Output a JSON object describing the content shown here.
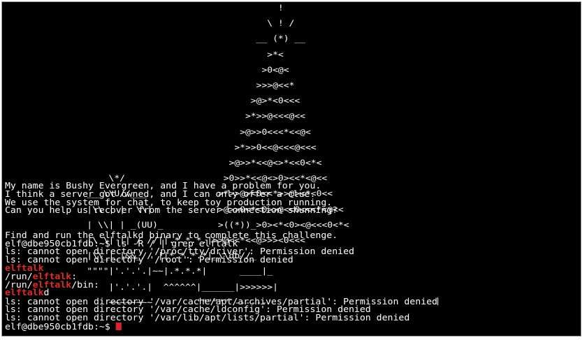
{
  "terminal": {
    "ascii_art": [
      "                                                  !",
      "                                                \\ ! /",
      "                                              __ (*) __",
      "                                                >*<",
      "                                               >0<@<",
      "                                              >>>@<<*",
      "                                             >@>*<0<<<",
      "                                            >*>>@<<<@<<",
      "                                           >@>>0<<<*<<@<",
      "                                          >*>>0<<@<<<@<<<",
      "                                         >@>>*<<@<>*<<0<*<",
      "                   \\*/                  >0>>*<<@<>0><<*<@<<",
      "               ___\\\\U//___             >*>>@><0<<*>>@><*<0<<",
      "               |\\\\ | |  \\\\|            >@>>0<*<0>>@<<0<<<*<@<<",
      "               | \\\\| | _(UU)_          >((*))_>0><*<0><@<<<0<*<",
      "               |\\ \\| || / //||.*.*.*.|>>@<<*<<@>>><0<<<",
      "               |\\\\_|_|&&_// ||*.*.*.*|_\\\\db//_",
      "               \"\"\"\"|'.'.'.|~~|.*.*.*|      ____|_",
      "                   |'.'.'.|  ^^^^^^|______|>>>>>>|",
      "                   ~~~~~~~~        '\"\"\"\"\"`------'"
    ],
    "output_lines": [
      [
        {
          "t": "My name is Bushy Evergreen, and I have a problem for you."
        }
      ],
      [
        {
          "t": "I think a server got owned, and I can only offer a clue."
        }
      ],
      [
        {
          "t": "We use the system for chat, to keep toy production running."
        }
      ],
      [
        {
          "t": "Can you help us recover from the server connection shunning?"
        }
      ],
      [],
      [],
      [
        {
          "t": "Find and run the elftalkd binary to complete this challenge."
        }
      ],
      [
        {
          "t": "elf@dbe950cb1fdb:~$ ls -R / | grep elftalk"
        }
      ],
      [
        {
          "t": "ls: cannot open directory '/proc/tty/driver': Permission denied"
        }
      ],
      [
        {
          "t": "ls: cannot open directory '/root': Permission denied"
        }
      ],
      [
        {
          "t": "elftalk",
          "hl": true
        }
      ],
      [
        {
          "t": "/run/"
        },
        {
          "t": "elftalk",
          "hl": true
        },
        {
          "t": ":"
        }
      ],
      [
        {
          "t": "/run/"
        },
        {
          "t": "elftalk",
          "hl": true
        },
        {
          "t": "/bin:"
        }
      ],
      [
        {
          "t": "elftalk",
          "hl": true
        },
        {
          "t": "d"
        }
      ],
      [
        {
          "t": "ls: cannot open directory '/var/cache/apt/archives/partial': Permission denied"
        },
        {
          "t": "",
          "caret": true
        }
      ],
      [
        {
          "t": "ls: cannot open directory '/var/cache/ldconfig': Permission denied"
        }
      ],
      [
        {
          "t": "ls: cannot open directory '/var/lib/apt/lists/partial': Permission denied"
        }
      ],
      [
        {
          "t": "elf@dbe950cb1fdb:~$ "
        },
        {
          "t": "",
          "cursor": true
        }
      ]
    ]
  },
  "colors": {
    "background": "#000000",
    "text": "#ffffff",
    "highlight": "#e02b2b",
    "cursor": "#d7262b"
  }
}
